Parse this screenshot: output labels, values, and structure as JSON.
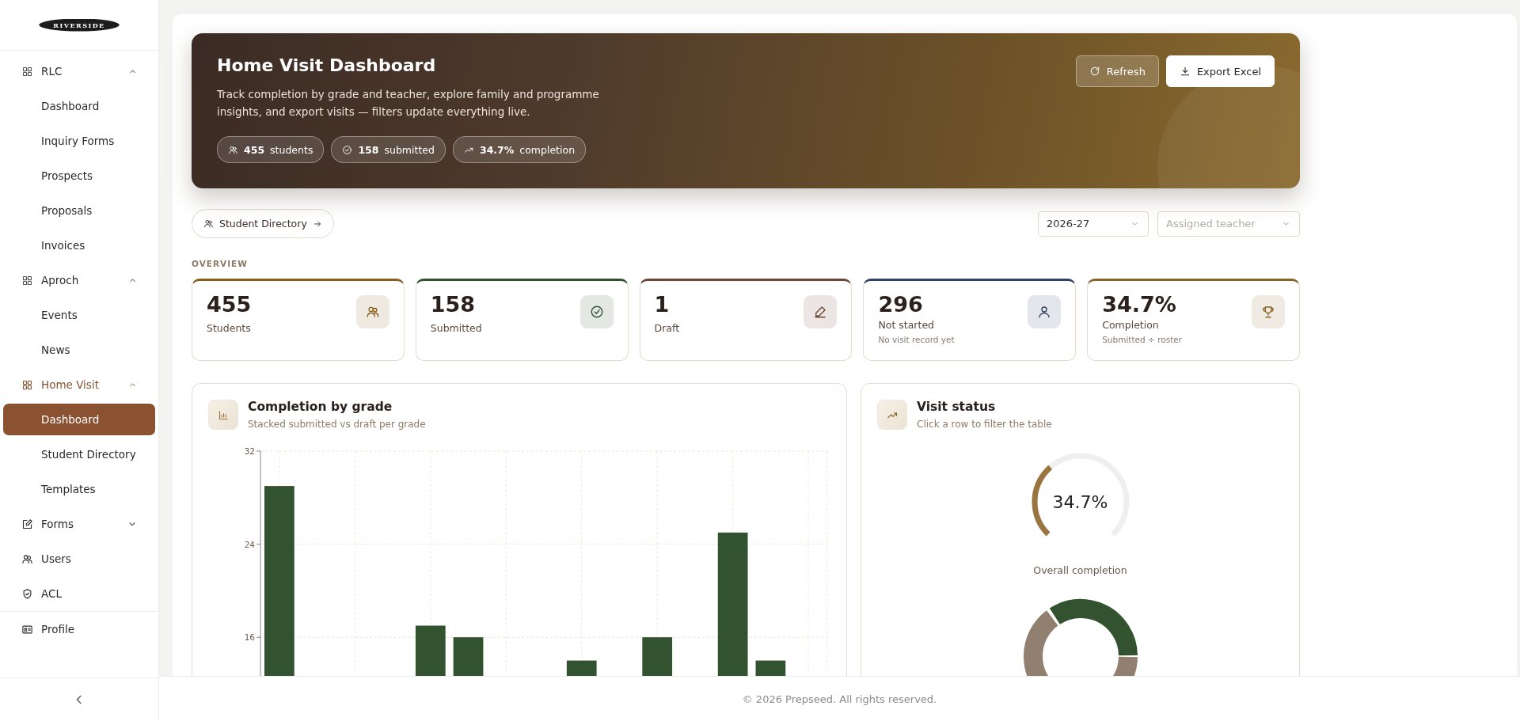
{
  "sidebar": {
    "logo": "RIVERSIDE",
    "items": [
      {
        "kind": "group",
        "label": "RLC",
        "expanded": true,
        "active": false,
        "children": [
          {
            "label": "Dashboard",
            "selected": false
          },
          {
            "label": "Inquiry Forms",
            "selected": false
          },
          {
            "label": "Prospects",
            "selected": false
          },
          {
            "label": "Proposals",
            "selected": false
          },
          {
            "label": "Invoices",
            "selected": false
          }
        ]
      },
      {
        "kind": "group",
        "label": "Aproch",
        "expanded": true,
        "active": false,
        "children": [
          {
            "label": "Events",
            "selected": false
          },
          {
            "label": "News",
            "selected": false
          }
        ]
      },
      {
        "kind": "group",
        "label": "Home Visit",
        "expanded": true,
        "active": true,
        "children": [
          {
            "label": "Dashboard",
            "selected": true
          },
          {
            "label": "Student Directory",
            "selected": false
          },
          {
            "label": "Templates",
            "selected": false
          }
        ]
      },
      {
        "kind": "group",
        "label": "Forms",
        "expanded": false,
        "active": false
      },
      {
        "kind": "link",
        "label": "Users"
      },
      {
        "kind": "link",
        "label": "ACL"
      }
    ],
    "bottom": [
      {
        "label": "Profile"
      }
    ]
  },
  "header": {
    "title": "Home Visit Dashboard",
    "description": "Track completion by grade and teacher, explore family and programme insights, and export visits — filters update everything live.",
    "chips": [
      {
        "value": "455",
        "label": "students"
      },
      {
        "value": "158",
        "label": "submitted"
      },
      {
        "value": "34.7%",
        "label": "completion"
      }
    ],
    "buttons": [
      "Refresh",
      "Export Excel"
    ]
  },
  "toolbar": {
    "link": "Student Directory",
    "filters": [
      {
        "value": "2026-27"
      },
      {
        "placeholder": "Assigned teacher"
      }
    ]
  },
  "overview": {
    "label": "OVERVIEW",
    "cards": [
      {
        "value": "455",
        "label": "Students",
        "color": "#8a5f1c"
      },
      {
        "value": "158",
        "label": "Submitted",
        "color": "#2f5130"
      },
      {
        "value": "1",
        "label": "Draft",
        "color": "#6b4535"
      },
      {
        "value": "296",
        "label": "Not started",
        "sub": "No visit record yet",
        "color": "#2f4168"
      },
      {
        "value": "34.7%",
        "label": "Completion",
        "sub": "Submitted ÷ roster",
        "color": "#8a6424"
      }
    ]
  },
  "grade_chart": {
    "title": "Completion by grade",
    "subtitle": "Stacked submitted vs draft per grade",
    "chart_data": {
      "type": "bar",
      "grid": true,
      "ylim": [
        0,
        32
      ],
      "yticks": [
        16,
        24,
        32
      ],
      "series": [
        {
          "color": "#33522f",
          "values": [
            29,
            null,
            null,
            null,
            17,
            16,
            null,
            null,
            14,
            null,
            16,
            null,
            25,
            14,
            null
          ]
        }
      ]
    }
  },
  "status": {
    "title": "Visit status",
    "subtitle": "Click a row to filter the table",
    "gauge": {
      "level": 0.347,
      "reading": "34.7%",
      "caption": "Overall completion"
    }
  },
  "footer": "© 2026 Prepseed. All rights reserved."
}
